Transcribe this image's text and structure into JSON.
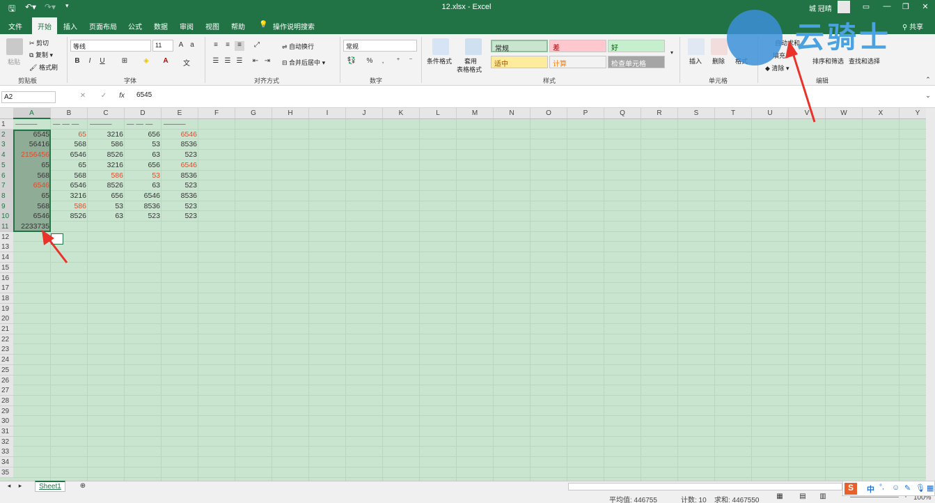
{
  "titlebar": {
    "title": "12.xlsx  -  Excel",
    "user": "城 冠晴",
    "save_icon": "save-icon",
    "undo_icon": "undo-icon",
    "redo_icon": "redo-icon"
  },
  "tabs": [
    "文件",
    "开始",
    "插入",
    "页面布局",
    "公式",
    "数据",
    "审阅",
    "视图",
    "帮助"
  ],
  "search_label": "操作说明搜索",
  "share_label": "共享",
  "ribbon": {
    "clipboard": {
      "paste": "粘贴",
      "cut": "剪切",
      "copy": "复制",
      "format_painter": "格式刷",
      "group": "剪贴板"
    },
    "font": {
      "name": "等线",
      "size": "11",
      "group": "字体"
    },
    "alignment": {
      "wrap": "自动换行",
      "merge": "合并后居中",
      "group": "对齐方式"
    },
    "number": {
      "format": "常规",
      "group": "数字"
    },
    "styles": {
      "conditional": "条件格式",
      "table_format": "套用\n表格格式",
      "cells": [
        "常规",
        "差",
        "好",
        "适中",
        "计算",
        "检查单元格"
      ],
      "group": "样式"
    },
    "cells_group": {
      "insert": "插入",
      "delete": "删除",
      "format": "格式",
      "group": "单元格"
    },
    "editing": {
      "autosum": "自动求和",
      "fill": "填充",
      "clear": "清除",
      "sort": "排序和筛选",
      "find": "查找和选择",
      "group": "编辑"
    }
  },
  "formula_bar": {
    "name_box": "A2",
    "fx": "fx",
    "value": "6545"
  },
  "columns": [
    "A",
    "B",
    "C",
    "D",
    "E",
    "F",
    "G",
    "H",
    "I",
    "J",
    "K",
    "L",
    "M",
    "N",
    "O",
    "P",
    "Q",
    "R",
    "S",
    "T",
    "U",
    "V",
    "W",
    "X",
    "Y"
  ],
  "rows": [
    "1",
    "2",
    "3",
    "4",
    "5",
    "6",
    "7",
    "8",
    "9",
    "10",
    "11",
    "12",
    "13",
    "14",
    "15",
    "16",
    "17",
    "18",
    "19",
    "20",
    "21",
    "22",
    "23",
    "24",
    "25",
    "26",
    "27",
    "28",
    "29",
    "30",
    "31",
    "32",
    "33",
    "34",
    "35"
  ],
  "header_row": [
    "———",
    "— — —",
    "———",
    "— — —",
    "———"
  ],
  "table": [
    [
      {
        "v": "6545",
        "r": false
      },
      {
        "v": "65",
        "r": true
      },
      {
        "v": "3216",
        "r": false
      },
      {
        "v": "656",
        "r": false
      },
      {
        "v": "6546",
        "r": true
      }
    ],
    [
      {
        "v": "56416",
        "r": false
      },
      {
        "v": "568",
        "r": false
      },
      {
        "v": "586",
        "r": false
      },
      {
        "v": "53",
        "r": false
      },
      {
        "v": "8536",
        "r": false
      }
    ],
    [
      {
        "v": "2156456",
        "r": true
      },
      {
        "v": "6546",
        "r": false
      },
      {
        "v": "8526",
        "r": false
      },
      {
        "v": "63",
        "r": false
      },
      {
        "v": "523",
        "r": false
      }
    ],
    [
      {
        "v": "65",
        "r": false
      },
      {
        "v": "65",
        "r": false
      },
      {
        "v": "3216",
        "r": false
      },
      {
        "v": "656",
        "r": false
      },
      {
        "v": "6546",
        "r": true
      }
    ],
    [
      {
        "v": "568",
        "r": false
      },
      {
        "v": "568",
        "r": false
      },
      {
        "v": "586",
        "r": true
      },
      {
        "v": "53",
        "r": true
      },
      {
        "v": "8536",
        "r": false
      }
    ],
    [
      {
        "v": "6546",
        "r": true
      },
      {
        "v": "6546",
        "r": false
      },
      {
        "v": "8526",
        "r": false
      },
      {
        "v": "63",
        "r": false
      },
      {
        "v": "523",
        "r": false
      }
    ],
    [
      {
        "v": "65",
        "r": false
      },
      {
        "v": "3216",
        "r": false
      },
      {
        "v": "656",
        "r": false
      },
      {
        "v": "6546",
        "r": false
      },
      {
        "v": "8536",
        "r": false
      }
    ],
    [
      {
        "v": "568",
        "r": false
      },
      {
        "v": "586",
        "r": true
      },
      {
        "v": "53",
        "r": false
      },
      {
        "v": "8536",
        "r": false
      },
      {
        "v": "523",
        "r": false
      }
    ],
    [
      {
        "v": "6546",
        "r": false
      },
      {
        "v": "8526",
        "r": false
      },
      {
        "v": "63",
        "r": false
      },
      {
        "v": "523",
        "r": false
      },
      {
        "v": "523",
        "r": false
      }
    ],
    [
      {
        "v": "2233735",
        "r": false
      }
    ]
  ],
  "sheet_tab": "Sheet1",
  "status": {
    "average": "平均值: 446755",
    "count": "计数: 10",
    "sum": "求和: 4467550",
    "zoom": "100%"
  },
  "watermark": {
    "text": "云骑士"
  },
  "ime": {
    "lang": "中"
  },
  "colors": {
    "excel_green": "#217346",
    "red_text": "#e04a2a",
    "arrow": "#e8322a"
  }
}
